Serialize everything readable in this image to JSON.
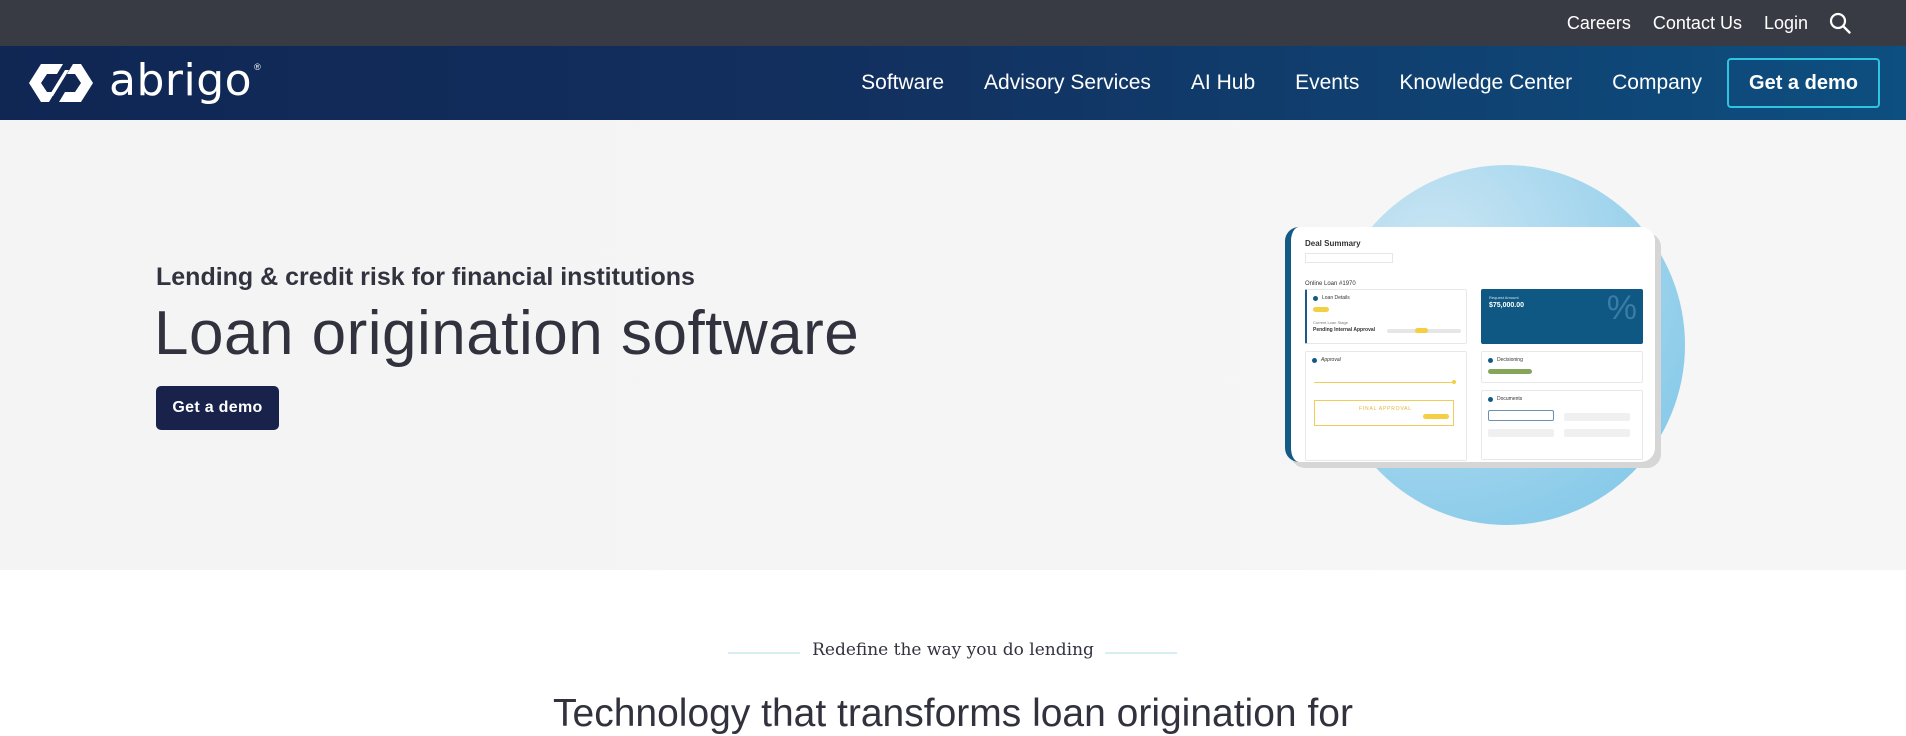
{
  "utility_bar": {
    "links": [
      "Careers",
      "Contact Us",
      "Login"
    ],
    "search_icon": "search-icon"
  },
  "nav": {
    "logo_text": "abrigo",
    "logo_registered": "®",
    "items": [
      "Software",
      "Advisory Services",
      "AI Hub",
      "Events",
      "Knowledge Center",
      "Company"
    ],
    "demo_button": "Get a demo"
  },
  "hero": {
    "eyebrow": "Lending & credit risk for financial institutions",
    "title": "Loan origination software",
    "demo_button": "Get a demo",
    "illustration": {
      "card_title": "Deal Summary",
      "loan_label": "Online Loan #1970",
      "loan_details": "Loan Details",
      "current_stage_label": "Current Loan Stage",
      "current_stage": "Pending Internal Approval",
      "request_amount_label": "Request Amount",
      "request_amount": "$75,000.00",
      "percent_symbol": "%",
      "approval": "Approval",
      "final_approval": "FINAL APPROVAL",
      "decisioning": "Decisioning",
      "documents": "Documents"
    }
  },
  "section": {
    "eyebrow": "Redefine the way you do lending",
    "heading": "Technology that transforms loan origination for"
  },
  "colors": {
    "utility_bg": "#393b44",
    "nav_bg_start": "#102653",
    "nav_bg_end": "#0d4f80",
    "accent_cyan": "#2fc4e0",
    "hero_button": "#18224a"
  }
}
